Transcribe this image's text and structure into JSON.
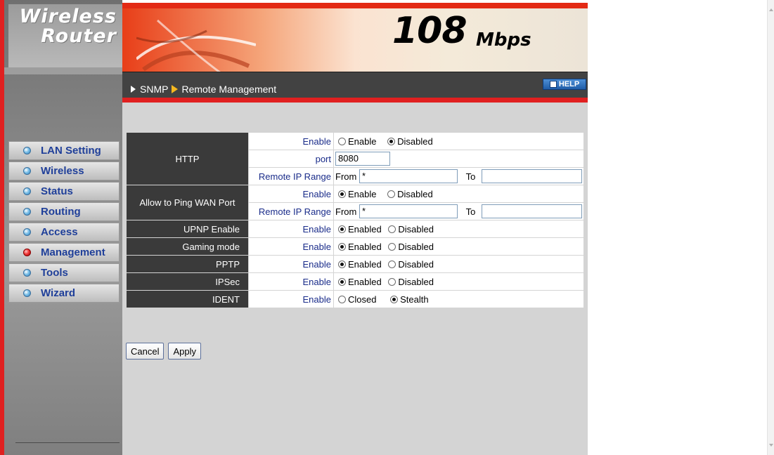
{
  "brand": {
    "line1": "Wireless",
    "line2": "Router",
    "speed": "108",
    "speed_unit": "Mbps"
  },
  "breadcrumb": {
    "section": "SNMP",
    "page": "Remote Management"
  },
  "help_label": "HELP",
  "nav": [
    {
      "label": "LAN Setting",
      "active": false
    },
    {
      "label": "Wireless",
      "active": false
    },
    {
      "label": "Status",
      "active": false
    },
    {
      "label": "Routing",
      "active": false
    },
    {
      "label": "Access",
      "active": false
    },
    {
      "label": "Management",
      "active": true
    },
    {
      "label": "Tools",
      "active": false
    },
    {
      "label": "Wizard",
      "active": false
    }
  ],
  "form": {
    "http": {
      "label": "HTTP",
      "enable_label": "Enable",
      "opt_enable": "Enable",
      "opt_disabled": "Disabled",
      "selected": "Disabled",
      "port_label": "port",
      "port_value": "8080",
      "range_label": "Remote IP Range",
      "from_label": "From",
      "from_value": "*",
      "to_label": "To",
      "to_value": ""
    },
    "ping": {
      "label": "Allow to Ping WAN Port",
      "enable_label": "Enable",
      "opt_enable": "Enable",
      "opt_disabled": "Disabled",
      "selected": "Enable",
      "range_label": "Remote IP Range",
      "from_label": "From",
      "from_value": "*",
      "to_label": "To",
      "to_value": ""
    },
    "upnp": {
      "label": "UPNP Enable",
      "enable_label": "Enable",
      "opt_a": "Enabled",
      "opt_b": "Disabled",
      "selected": "Enabled"
    },
    "gaming": {
      "label": "Gaming mode",
      "enable_label": "Enable",
      "opt_a": "Enabled",
      "opt_b": "Disabled",
      "selected": "Enabled"
    },
    "pptp": {
      "label": "PPTP",
      "enable_label": "Enable",
      "opt_a": "Enabled",
      "opt_b": "Disabled",
      "selected": "Enabled"
    },
    "ipsec": {
      "label": "IPSec",
      "enable_label": "Enable",
      "opt_a": "Enabled",
      "opt_b": "Disabled",
      "selected": "Enabled"
    },
    "ident": {
      "label": "IDENT",
      "enable_label": "Enable",
      "opt_a": "Closed",
      "opt_b": "Stealth",
      "selected": "Stealth"
    }
  },
  "buttons": {
    "cancel": "Cancel",
    "apply": "Apply"
  },
  "colors": {
    "accent_red": "#e02020",
    "nav_text": "#1f3f99",
    "label_bg": "#3a3a3a",
    "content_bg": "#d4d4d4"
  }
}
